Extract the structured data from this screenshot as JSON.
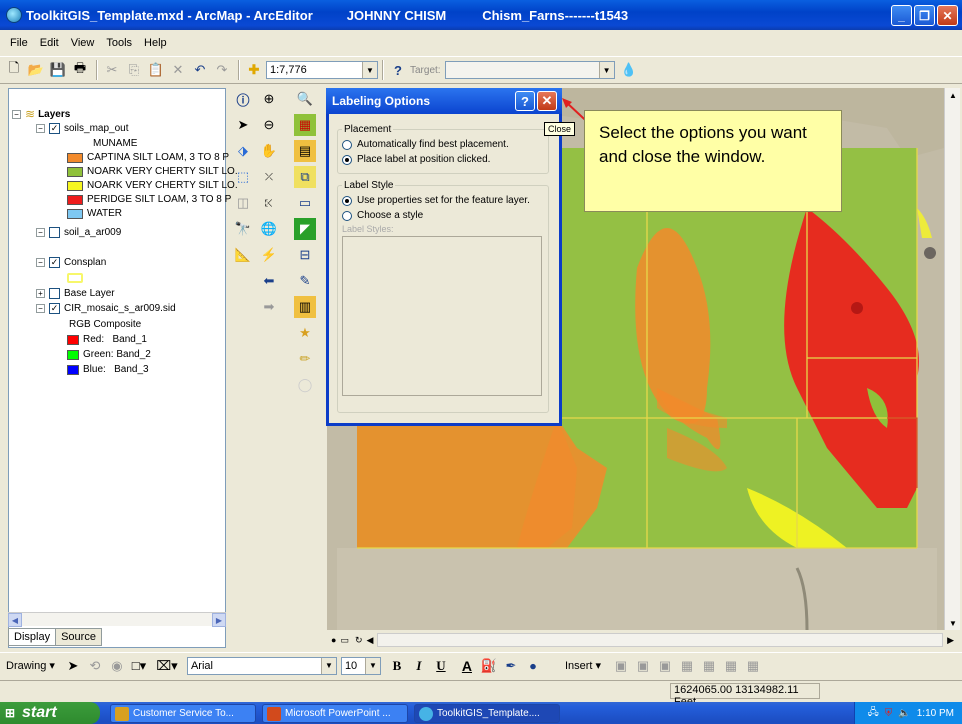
{
  "window": {
    "title": "ToolkitGIS_Template.mxd - ArcMap - ArcEditor",
    "user": "JOHNNY CHISM",
    "project": "Chism_Farns-------t1543",
    "buttons": [
      "_",
      "❐",
      "✕"
    ]
  },
  "menu": [
    "File",
    "Edit",
    "View",
    "Tools",
    "Help"
  ],
  "toolbar": {
    "scale": "1:7,776",
    "target_label": "Target:",
    "target_value": ""
  },
  "toc": {
    "root": "Layers",
    "layers": [
      {
        "name": "soils_map_out",
        "checked": true,
        "expanded": true
      },
      {
        "name": "soil_a_ar009",
        "checked": false,
        "expanded": false
      },
      {
        "name": "Consplan",
        "checked": true,
        "expanded": true
      },
      {
        "name": "Base Layer",
        "checked": false,
        "expanded": false
      },
      {
        "name": "CIR_mosaic_s_ar009.sid",
        "checked": true,
        "expanded": true
      }
    ],
    "field_heading": "MUNAME",
    "legend_soils": [
      {
        "label": "CAPTINA SILT LOAM, 3 TO 8 P",
        "color": "#f28a2c"
      },
      {
        "label": "NOARK VERY CHERTY SILT LO.",
        "color": "#8fc13a"
      },
      {
        "label": "NOARK VERY CHERTY SILT LO.",
        "color": "#f7f720"
      },
      {
        "label": "PERIDGE SILT LOAM, 3 TO 8 P",
        "color": "#ee1c1c"
      },
      {
        "label": "WATER",
        "color": "#7ec8f2"
      }
    ],
    "consplan_color": "#f7f76a",
    "rgb_heading": "RGB Composite",
    "bands": [
      {
        "label": "Red:   Band_1",
        "color": "#ff0000"
      },
      {
        "label": "Green: Band_2",
        "color": "#00ff00"
      },
      {
        "label": "Blue:   Band_3",
        "color": "#0000ff"
      }
    ],
    "tabs": [
      "Display",
      "Source"
    ]
  },
  "dialog": {
    "title": "Labeling Options",
    "help": "?",
    "close": "✕",
    "close_tooltip": "Close",
    "placement_legend": "Placement",
    "placement_options": [
      "Automatically find best placement.",
      "Place label at position clicked."
    ],
    "placement_selected": 1,
    "style_legend": "Label Style",
    "style_options": [
      "Use properties set for the feature layer.",
      "Choose a style"
    ],
    "style_selected": 0,
    "styles_label": "Label Styles:"
  },
  "callout": "Select the options you want and close the window.",
  "drawing_toolbar": {
    "drawing_label": "Drawing ▾",
    "font": "Arial",
    "size": "10",
    "bold": "B",
    "italic": "I",
    "underline": "U",
    "font_color": "A",
    "insert_label": "Insert ▾"
  },
  "status": {
    "coordinates": "1624065.00  13134982.11 Feet"
  },
  "taskbar": {
    "start": "start",
    "tasks": [
      {
        "label": "Customer Service To...",
        "active": false,
        "color": "#d8a020"
      },
      {
        "label": "Microsoft PowerPoint ...",
        "active": false,
        "color": "#d24a1c"
      },
      {
        "label": "ToolkitGIS_Template....",
        "active": true,
        "color": "#46b3e6"
      }
    ],
    "time": "1:10 PM"
  },
  "colors": {
    "soil_orange": "#f28a2c",
    "soil_green": "#8fc13a",
    "soil_yellow": "#f7f720",
    "soil_red": "#ee1c1c"
  }
}
